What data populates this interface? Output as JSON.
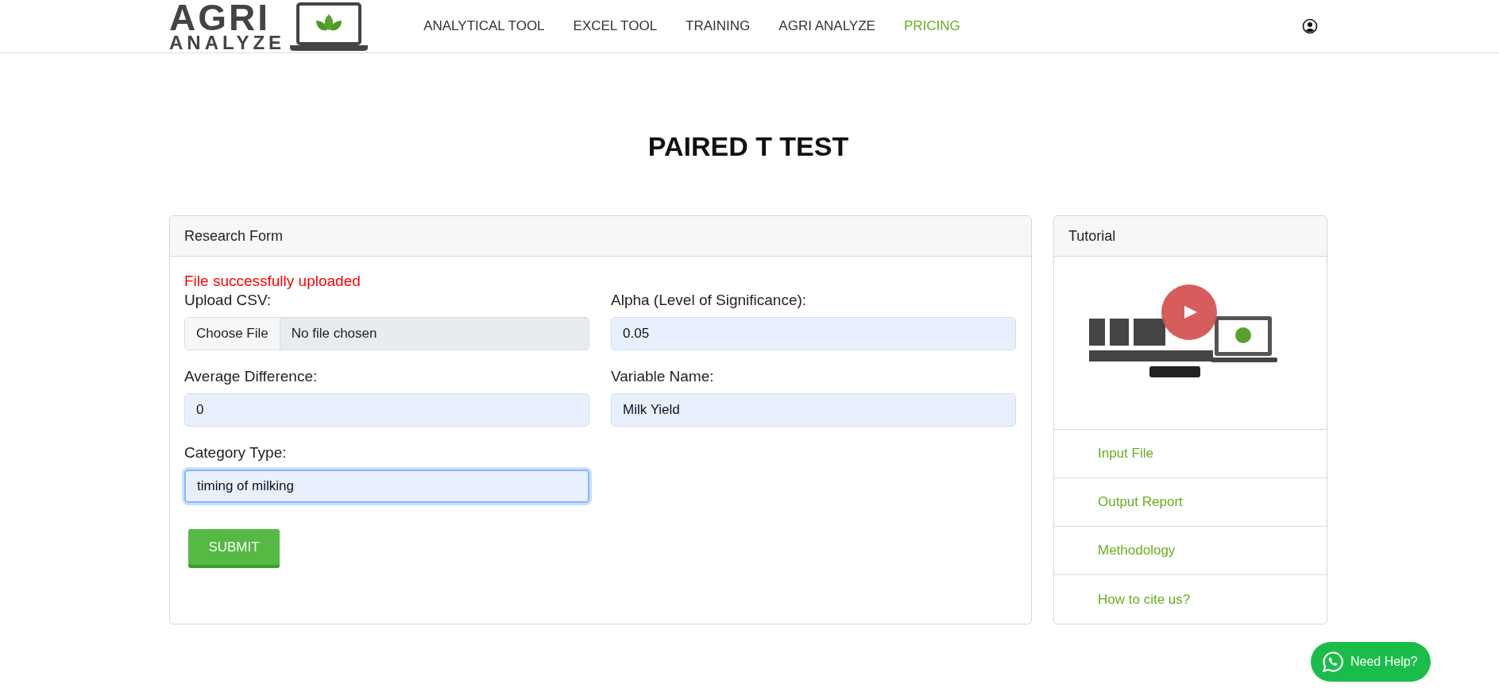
{
  "logo": {
    "line_1": "AGRI",
    "line_2": "ANALYZE"
  },
  "nav": [
    {
      "label": "ANALYTICAL TOOL",
      "selected": false
    },
    {
      "label": "EXCEL TOOL",
      "selected": false
    },
    {
      "label": "TRAINING",
      "selected": false
    },
    {
      "label": "AGRI ANALYZE",
      "selected": false
    },
    {
      "label": "PRICING",
      "selected": true
    }
  ],
  "page_title": "PAIRED T TEST",
  "research_form": {
    "title": "Research Form",
    "message": "File successfully uploaded",
    "fields": [
      {
        "kind": "file",
        "label": "Upload CSV:",
        "button": "Choose File",
        "value": "No file chosen"
      },
      {
        "kind": "text",
        "label": "Alpha (Level of Significance):",
        "value": "0.05",
        "focused": false
      },
      {
        "kind": "text",
        "label": "Average Difference:",
        "value": "0",
        "focused": false
      },
      {
        "kind": "text",
        "label": "Variable Name:",
        "value": "Milk Yield",
        "focused": false
      },
      {
        "kind": "text",
        "label": "Category Type:",
        "value": "timing of milking",
        "focused": true
      }
    ],
    "submit": "SUBMIT"
  },
  "tutorial": {
    "title": "Tutorial",
    "video": {
      "kind": "picture"
    },
    "links": [
      "Input File",
      "Output Report",
      "Methodology",
      "How to cite us?"
    ]
  },
  "help_button": "Need Help?"
}
